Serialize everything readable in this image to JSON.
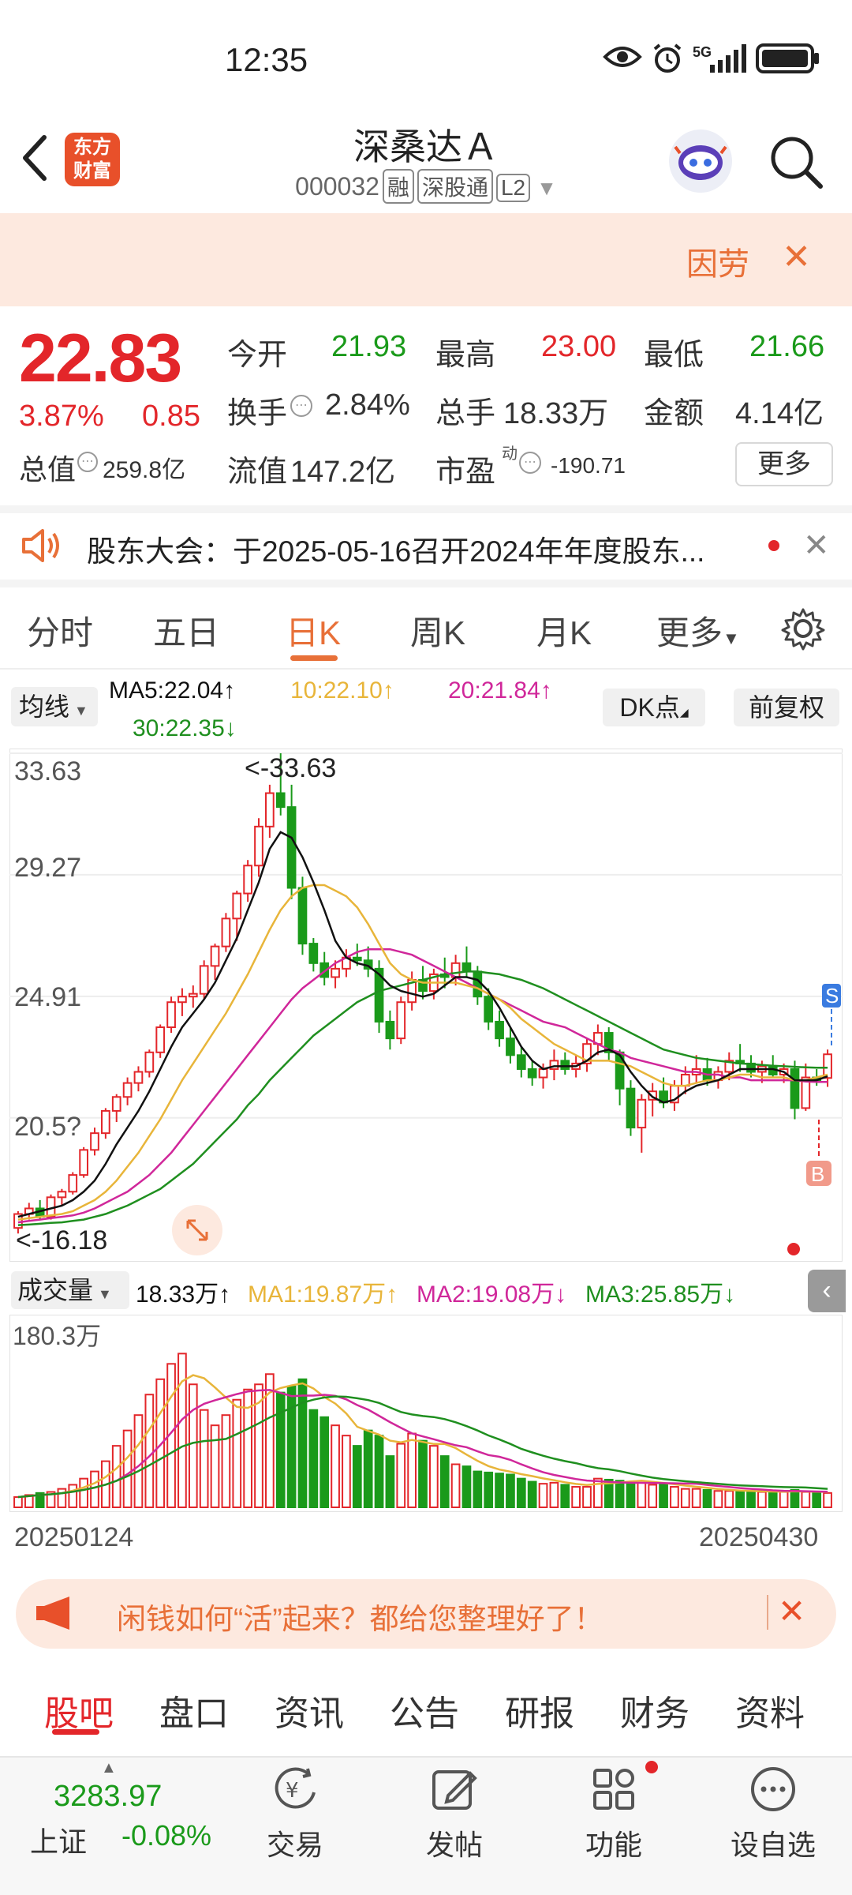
{
  "status_bar": {
    "time": "12:35",
    "network": "5G"
  },
  "header": {
    "stock_name": "深桑达Ａ",
    "stock_code": "000032",
    "tags": [
      "融",
      "深股通",
      "L2"
    ],
    "app_logo": "东方财富"
  },
  "banner": {
    "text": "因劳"
  },
  "quote": {
    "price": "22.83",
    "change_pct": "3.87%",
    "change_amt": "0.85",
    "open_label": "今开",
    "open": "21.93",
    "high_label": "最高",
    "high": "23.00",
    "low_label": "最低",
    "low": "21.66",
    "turnover_label": "换手",
    "turnover": "2.84%",
    "volume_label": "总手",
    "volume": "18.33万",
    "amount_label": "金额",
    "amount": "4.14亿",
    "mktcap_label": "总值",
    "mktcap": "259.8亿",
    "float_label": "流值",
    "float_cap": "147.2亿",
    "pe_label": "市盈",
    "pe_sup": "动",
    "pe": "-190.71",
    "more_label": "更多"
  },
  "notice": {
    "text": "股东大会：于2025-05-16召开2024年年度股东..."
  },
  "chart_tabs": [
    "分时",
    "五日",
    "日K",
    "周K",
    "月K",
    "更多"
  ],
  "active_chart_tab": "日K",
  "ma_legend": {
    "selector": "均线",
    "ma5": "MA5:22.04↑",
    "ma10": "10:22.10↑",
    "ma20": "20:21.84↑",
    "ma30": "30:22.35↓",
    "dk_button": "DK点",
    "fq_button": "前复权"
  },
  "colors": {
    "up": "#e3262a",
    "down": "#1a9a1a",
    "ma5": "#111111",
    "ma10": "#e8b53a",
    "ma20": "#d0279a",
    "ma30": "#1f8f1f",
    "accent": "#e87038"
  },
  "chart_data": {
    "type": "candlestick",
    "y_ticks": [
      "33.63",
      "29.27",
      "24.91",
      "20.5?"
    ],
    "ylim": [
      16.18,
      33.63
    ],
    "max_label": "<-33.63",
    "min_label": "<-16.18",
    "x_start": "20250124",
    "x_end": "20250430",
    "markers": [
      "S",
      "B"
    ],
    "candles": [
      [
        16.6,
        17.2,
        16.4,
        17.1
      ],
      [
        17.1,
        17.5,
        16.9,
        17.3
      ],
      [
        17.3,
        17.6,
        16.9,
        17.0
      ],
      [
        17.0,
        17.8,
        16.9,
        17.7
      ],
      [
        17.7,
        18.0,
        17.4,
        17.9
      ],
      [
        17.9,
        18.6,
        17.8,
        18.5
      ],
      [
        18.5,
        19.5,
        18.4,
        19.4
      ],
      [
        19.4,
        20.2,
        19.2,
        20.0
      ],
      [
        20.0,
        20.9,
        19.8,
        20.8
      ],
      [
        20.8,
        21.4,
        20.4,
        21.3
      ],
      [
        21.3,
        22.0,
        21.0,
        21.8
      ],
      [
        21.8,
        22.4,
        21.5,
        22.2
      ],
      [
        22.2,
        23.0,
        22.0,
        22.9
      ],
      [
        22.9,
        23.9,
        22.7,
        23.8
      ],
      [
        23.8,
        24.9,
        23.6,
        24.7
      ],
      [
        24.7,
        25.2,
        24.2,
        24.9
      ],
      [
        24.9,
        25.3,
        24.5,
        25.0
      ],
      [
        25.0,
        26.2,
        24.8,
        26.0
      ],
      [
        26.0,
        26.8,
        25.5,
        26.7
      ],
      [
        26.7,
        27.9,
        26.5,
        27.7
      ],
      [
        27.7,
        28.7,
        26.9,
        28.6
      ],
      [
        28.6,
        29.8,
        28.3,
        29.6
      ],
      [
        29.6,
        31.3,
        29.2,
        31.0
      ],
      [
        31.0,
        32.5,
        30.6,
        32.2
      ],
      [
        32.2,
        33.63,
        31.4,
        31.7
      ],
      [
        31.7,
        32.5,
        28.4,
        28.8
      ],
      [
        28.8,
        29.2,
        26.4,
        26.8
      ],
      [
        26.8,
        27.0,
        25.8,
        26.1
      ],
      [
        26.1,
        26.5,
        25.3,
        25.6
      ],
      [
        25.6,
        26.2,
        25.2,
        25.9
      ],
      [
        25.9,
        26.6,
        25.6,
        26.3
      ],
      [
        26.3,
        26.8,
        26.0,
        26.2
      ],
      [
        26.2,
        26.7,
        25.6,
        25.9
      ],
      [
        25.9,
        26.2,
        23.6,
        24.0
      ],
      [
        24.0,
        24.4,
        23.0,
        23.4
      ],
      [
        23.4,
        24.9,
        23.2,
        24.7
      ],
      [
        24.7,
        25.8,
        24.4,
        25.5
      ],
      [
        25.5,
        26.0,
        24.8,
        25.1
      ],
      [
        25.1,
        25.9,
        24.8,
        25.7
      ],
      [
        25.7,
        26.3,
        25.2,
        25.6
      ],
      [
        25.6,
        26.4,
        25.3,
        26.1
      ],
      [
        26.1,
        26.7,
        25.6,
        25.8
      ],
      [
        25.8,
        26.0,
        24.6,
        24.9
      ],
      [
        24.9,
        25.2,
        23.7,
        24.0
      ],
      [
        24.0,
        24.4,
        23.1,
        23.4
      ],
      [
        23.4,
        23.8,
        22.5,
        22.8
      ],
      [
        22.8,
        23.1,
        22.0,
        22.3
      ],
      [
        22.3,
        22.6,
        21.7,
        22.0
      ],
      [
        22.0,
        22.5,
        21.6,
        22.3
      ],
      [
        22.3,
        23.0,
        21.9,
        22.6
      ],
      [
        22.6,
        22.9,
        22.1,
        22.3
      ],
      [
        22.3,
        22.8,
        22.0,
        22.5
      ],
      [
        22.5,
        23.4,
        22.2,
        23.2
      ],
      [
        23.2,
        23.9,
        22.8,
        23.6
      ],
      [
        23.6,
        23.8,
        22.6,
        22.9
      ],
      [
        22.9,
        23.0,
        21.0,
        21.6
      ],
      [
        21.6,
        21.9,
        19.9,
        20.2
      ],
      [
        20.2,
        21.4,
        19.3,
        21.2
      ],
      [
        21.2,
        21.8,
        20.6,
        21.5
      ],
      [
        21.5,
        22.0,
        20.9,
        21.1
      ],
      [
        21.1,
        21.9,
        20.8,
        21.7
      ],
      [
        21.7,
        22.4,
        21.4,
        22.1
      ],
      [
        22.1,
        22.8,
        21.8,
        22.3
      ],
      [
        22.3,
        22.7,
        21.7,
        21.9
      ],
      [
        21.9,
        22.4,
        21.6,
        22.2
      ],
      [
        22.2,
        22.9,
        21.9,
        22.6
      ],
      [
        22.6,
        23.2,
        22.2,
        22.5
      ],
      [
        22.5,
        22.8,
        22.0,
        22.2
      ],
      [
        22.2,
        22.6,
        21.8,
        22.4
      ],
      [
        22.4,
        22.8,
        22.0,
        22.1
      ],
      [
        22.1,
        22.5,
        21.8,
        22.3
      ],
      [
        22.3,
        22.6,
        20.5,
        20.9
      ],
      [
        20.9,
        22.5,
        20.8,
        22.0
      ],
      [
        22.0,
        22.3,
        21.7,
        21.9
      ],
      [
        21.98,
        23.0,
        21.66,
        22.83
      ]
    ],
    "ma5": [
      17.0,
      17.1,
      17.2,
      17.3,
      17.4,
      17.6,
      17.9,
      18.3,
      18.9,
      19.6,
      20.2,
      20.8,
      21.5,
      22.3,
      23.1,
      23.8,
      24.3,
      24.8,
      25.4,
      26.2,
      27.0,
      28.0,
      29.0,
      30.2,
      30.8,
      30.6,
      29.9,
      29.0,
      28.0,
      26.9,
      26.3,
      26.1,
      26.0,
      25.7,
      25.3,
      25.1,
      25.0,
      24.9,
      25.0,
      25.3,
      25.6,
      25.6,
      25.5,
      25.1,
      24.5,
      23.8,
      23.1,
      22.6,
      22.3,
      22.4,
      22.4,
      22.4,
      22.6,
      22.9,
      23.0,
      22.8,
      22.2,
      21.7,
      21.3,
      21.1,
      21.2,
      21.5,
      21.7,
      21.8,
      21.9,
      22.1,
      22.3,
      22.3,
      22.3,
      22.3,
      22.2,
      21.9,
      21.9,
      21.9,
      22.04
    ],
    "ma10": [
      16.9,
      16.95,
      17.0,
      17.05,
      17.1,
      17.2,
      17.4,
      17.6,
      17.9,
      18.3,
      18.8,
      19.3,
      19.9,
      20.5,
      21.2,
      21.9,
      22.5,
      23.1,
      23.7,
      24.3,
      25.0,
      25.7,
      26.5,
      27.3,
      28.0,
      28.5,
      28.8,
      28.9,
      28.9,
      28.7,
      28.5,
      28.1,
      27.5,
      26.8,
      26.1,
      25.7,
      25.5,
      25.4,
      25.4,
      25.4,
      25.4,
      25.3,
      25.2,
      25.0,
      24.8,
      24.5,
      24.1,
      23.8,
      23.5,
      23.2,
      23.0,
      22.8,
      22.6,
      22.6,
      22.6,
      22.5,
      22.4,
      22.2,
      22.0,
      21.8,
      21.7,
      21.7,
      21.8,
      21.9,
      21.9,
      22.0,
      22.1,
      22.1,
      22.0,
      22.0,
      22.0,
      21.9,
      21.9,
      22.0,
      22.1
    ],
    "ma20": [
      16.8,
      16.85,
      16.9,
      16.95,
      17.0,
      17.05,
      17.15,
      17.3,
      17.5,
      17.7,
      17.9,
      18.2,
      18.5,
      18.9,
      19.3,
      19.8,
      20.3,
      20.8,
      21.3,
      21.8,
      22.3,
      22.8,
      23.3,
      23.8,
      24.3,
      24.8,
      25.2,
      25.5,
      25.8,
      26.1,
      26.3,
      26.5,
      26.6,
      26.6,
      26.6,
      26.5,
      26.4,
      26.2,
      26.0,
      25.8,
      25.6,
      25.4,
      25.2,
      25.0,
      24.8,
      24.6,
      24.4,
      24.2,
      24.0,
      23.9,
      23.8,
      23.6,
      23.4,
      23.2,
      23.0,
      22.9,
      22.7,
      22.6,
      22.5,
      22.4,
      22.3,
      22.2,
      22.2,
      22.1,
      22.1,
      22.0,
      22.0,
      21.9,
      21.9,
      21.9,
      21.9,
      21.9,
      21.85,
      21.84,
      21.84
    ],
    "ma30": [
      16.7,
      16.72,
      16.75,
      16.78,
      16.8,
      16.85,
      16.9,
      17.0,
      17.1,
      17.25,
      17.4,
      17.6,
      17.8,
      18.0,
      18.3,
      18.6,
      18.9,
      19.3,
      19.7,
      20.1,
      20.5,
      21.0,
      21.4,
      21.9,
      22.3,
      22.7,
      23.1,
      23.5,
      23.8,
      24.1,
      24.4,
      24.7,
      24.9,
      25.1,
      25.2,
      25.3,
      25.4,
      25.5,
      25.6,
      25.7,
      25.75,
      25.8,
      25.8,
      25.75,
      25.7,
      25.6,
      25.5,
      25.35,
      25.2,
      25.0,
      24.8,
      24.6,
      24.4,
      24.2,
      24.0,
      23.8,
      23.6,
      23.4,
      23.2,
      23.0,
      22.9,
      22.8,
      22.7,
      22.65,
      22.6,
      22.55,
      22.5,
      22.48,
      22.45,
      22.42,
      22.4,
      22.38,
      22.36,
      22.35,
      22.35
    ],
    "volume_max": "180.3万",
    "volumes": [
      10,
      12,
      14,
      15,
      18,
      22,
      28,
      35,
      45,
      60,
      75,
      90,
      110,
      125,
      140,
      150,
      120,
      95,
      80,
      90,
      105,
      115,
      120,
      130,
      112,
      118,
      125,
      95,
      88,
      80,
      70,
      60,
      75,
      70,
      50,
      62,
      72,
      65,
      60,
      50,
      42,
      40,
      35,
      34,
      33,
      32,
      28,
      25,
      23,
      24,
      22,
      20,
      20,
      28,
      27,
      26,
      25,
      24,
      22,
      22,
      20,
      18,
      18,
      17,
      16,
      16,
      15,
      16,
      15,
      15,
      15,
      17,
      15,
      14,
      14
    ]
  },
  "volume_legend": {
    "selector": "成交量",
    "value": "18.33万↑",
    "ma1": "MA1:19.87万↑",
    "ma2": "MA2:19.08万↓",
    "ma3": "MA3:25.85万↓"
  },
  "promo": {
    "text": "闲钱如何“活”起来？都给您整理好了！"
  },
  "bottom_tabs": [
    "股吧",
    "盘口",
    "资讯",
    "公告",
    "研报",
    "财务",
    "资料"
  ],
  "active_bottom_tab": "股吧",
  "bottom_nav": {
    "index_value": "3283.97",
    "index_name": "上证",
    "index_change": "-0.08%",
    "items": [
      "交易",
      "发帖",
      "功能",
      "设自选"
    ]
  }
}
